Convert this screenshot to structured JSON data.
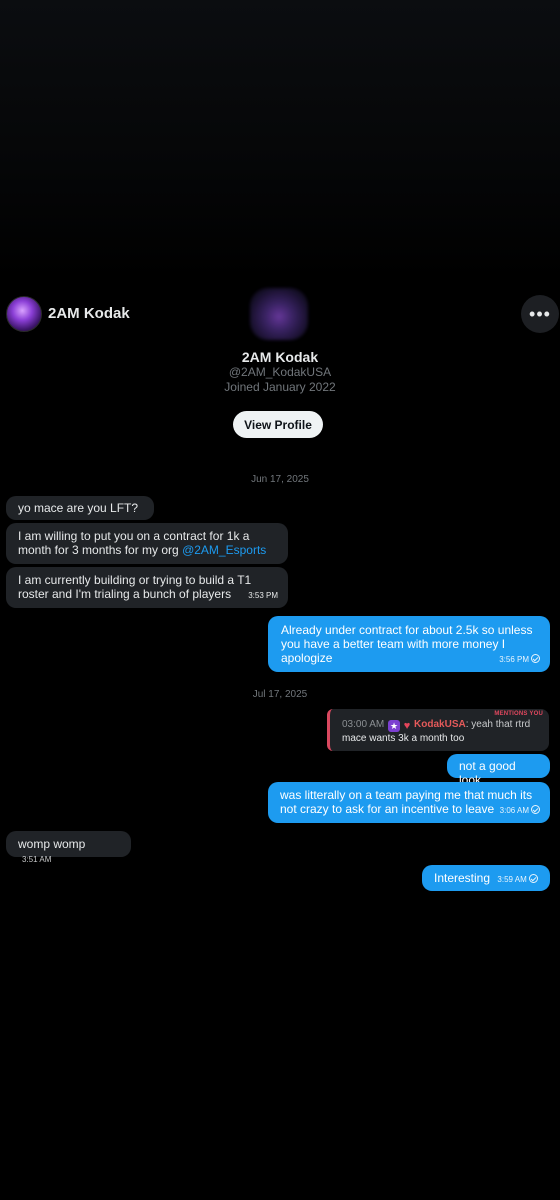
{
  "header": {
    "name": "2AM Kodak",
    "more_icon": "more-horizontal-icon",
    "more_label": "•••"
  },
  "profile": {
    "name": "2AM Kodak",
    "handle": "@2AM_KodakUSA",
    "joined": "Joined January 2022",
    "view_profile_label": "View Profile"
  },
  "dates": {
    "first": "Jun 17, 2025",
    "second": "Jul 17, 2025"
  },
  "messages": {
    "m1": {
      "text": "yo mace are you LFT?"
    },
    "m2": {
      "text": "I am willing to put you on a contract for 1k a month for 3 months for my org ",
      "link": "@2AM_Esports"
    },
    "m3": {
      "text": "I am currently building or trying to build a T1 roster and I'm trialing a bunch of players",
      "time": "3:53 PM"
    },
    "m4": {
      "text": "Already under contract for about 2.5k so unless you have a better team with more money I apologize",
      "time": "3:56 PM"
    },
    "quote": {
      "tag": "MENTIONS YOU",
      "time": "03:00 AM",
      "user": "KodakUSA",
      "text1": ": yeah that rtrd",
      "text2": "mace wants 3k a month too",
      "star_icon": "star-badge-icon",
      "heart_icon": "heart-badge-icon"
    },
    "m5": {
      "text": "not a good look"
    },
    "m6": {
      "text": "was litterally on a team paying me that much its not crazy to ask for an incentive to leave",
      "time": "3:06 AM"
    },
    "m7": {
      "text": "womp womp",
      "time": "3:51 AM"
    },
    "m8": {
      "text": "Interesting",
      "time": "3:59 AM"
    }
  },
  "colors": {
    "background": "#000000",
    "incoming_bubble": "#202327",
    "outgoing_bubble": "#1d9bf0",
    "link": "#1d9bf0",
    "muted_text": "#71767b"
  }
}
